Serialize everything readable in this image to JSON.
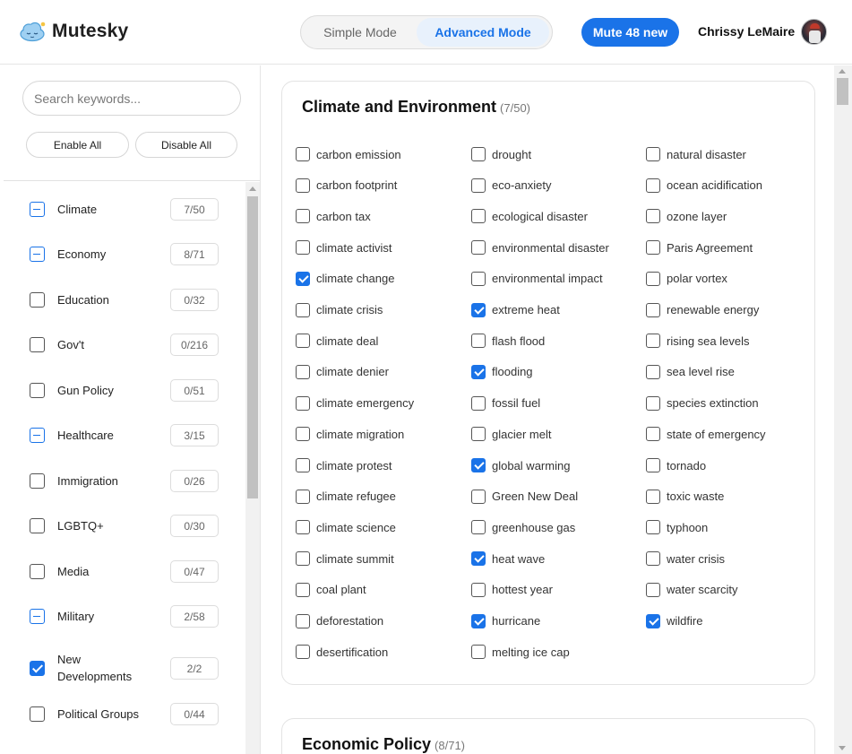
{
  "app": {
    "name": "Mutesky"
  },
  "header": {
    "mode_simple": "Simple Mode",
    "mode_advanced": "Advanced Mode",
    "active_mode": "Advanced Mode",
    "mute_button": "Mute 48 new",
    "user_name": "Chrissy LeMaire"
  },
  "colors": {
    "accent": "#1a73e8",
    "border": "#e3e3e3",
    "text": "#222222"
  },
  "sidebar": {
    "search_placeholder": "Search keywords...",
    "enable_all": "Enable All",
    "disable_all": "Disable All",
    "categories": [
      {
        "label": "Climate",
        "count": "7/50",
        "state": "partial"
      },
      {
        "label": "Economy",
        "count": "8/71",
        "state": "partial"
      },
      {
        "label": "Education",
        "count": "0/32",
        "state": "unchecked"
      },
      {
        "label": "Gov't",
        "count": "0/216",
        "state": "unchecked"
      },
      {
        "label": "Gun Policy",
        "count": "0/51",
        "state": "unchecked"
      },
      {
        "label": "Healthcare",
        "count": "3/15",
        "state": "partial"
      },
      {
        "label": "Immigration",
        "count": "0/26",
        "state": "unchecked"
      },
      {
        "label": "LGBTQ+",
        "count": "0/30",
        "state": "unchecked"
      },
      {
        "label": "Media",
        "count": "0/47",
        "state": "unchecked"
      },
      {
        "label": "Military",
        "count": "2/58",
        "state": "partial"
      },
      {
        "label": "New Developments",
        "count": "2/2",
        "state": "checked"
      },
      {
        "label": "Political Groups",
        "count": "0/44",
        "state": "unchecked"
      }
    ]
  },
  "main": {
    "sections": [
      {
        "title": "Climate and Environment",
        "count": "(7/50)",
        "columns": [
          [
            {
              "label": "carbon emission",
              "checked": false
            },
            {
              "label": "carbon footprint",
              "checked": false
            },
            {
              "label": "carbon tax",
              "checked": false
            },
            {
              "label": "climate activist",
              "checked": false
            },
            {
              "label": "climate change",
              "checked": true
            },
            {
              "label": "climate crisis",
              "checked": false
            },
            {
              "label": "climate deal",
              "checked": false
            },
            {
              "label": "climate denier",
              "checked": false
            },
            {
              "label": "climate emergency",
              "checked": false
            },
            {
              "label": "climate migration",
              "checked": false
            },
            {
              "label": "climate protest",
              "checked": false
            },
            {
              "label": "climate refugee",
              "checked": false
            },
            {
              "label": "climate science",
              "checked": false
            },
            {
              "label": "climate summit",
              "checked": false
            },
            {
              "label": "coal plant",
              "checked": false
            },
            {
              "label": "deforestation",
              "checked": false
            },
            {
              "label": "desertification",
              "checked": false
            }
          ],
          [
            {
              "label": "drought",
              "checked": false
            },
            {
              "label": "eco-anxiety",
              "checked": false
            },
            {
              "label": "ecological disaster",
              "checked": false
            },
            {
              "label": "environmental disaster",
              "checked": false
            },
            {
              "label": "environmental impact",
              "checked": false
            },
            {
              "label": "extreme heat",
              "checked": true
            },
            {
              "label": "flash flood",
              "checked": false
            },
            {
              "label": "flooding",
              "checked": true
            },
            {
              "label": "fossil fuel",
              "checked": false
            },
            {
              "label": "glacier melt",
              "checked": false
            },
            {
              "label": "global warming",
              "checked": true
            },
            {
              "label": "Green New Deal",
              "checked": false
            },
            {
              "label": "greenhouse gas",
              "checked": false
            },
            {
              "label": "heat wave",
              "checked": true
            },
            {
              "label": "hottest year",
              "checked": false
            },
            {
              "label": "hurricane",
              "checked": true
            },
            {
              "label": "melting ice cap",
              "checked": false
            }
          ],
          [
            {
              "label": "natural disaster",
              "checked": false
            },
            {
              "label": "ocean acidification",
              "checked": false
            },
            {
              "label": "ozone layer",
              "checked": false
            },
            {
              "label": "Paris Agreement",
              "checked": false
            },
            {
              "label": "polar vortex",
              "checked": false
            },
            {
              "label": "renewable energy",
              "checked": false
            },
            {
              "label": "rising sea levels",
              "checked": false
            },
            {
              "label": "sea level rise",
              "checked": false
            },
            {
              "label": "species extinction",
              "checked": false
            },
            {
              "label": "state of emergency",
              "checked": false
            },
            {
              "label": "tornado",
              "checked": false
            },
            {
              "label": "toxic waste",
              "checked": false
            },
            {
              "label": "typhoon",
              "checked": false
            },
            {
              "label": "water crisis",
              "checked": false
            },
            {
              "label": "water scarcity",
              "checked": false
            },
            {
              "label": "wildfire",
              "checked": true
            }
          ]
        ]
      },
      {
        "title": "Economic Policy",
        "count": "(8/71)",
        "columns": []
      }
    ]
  }
}
